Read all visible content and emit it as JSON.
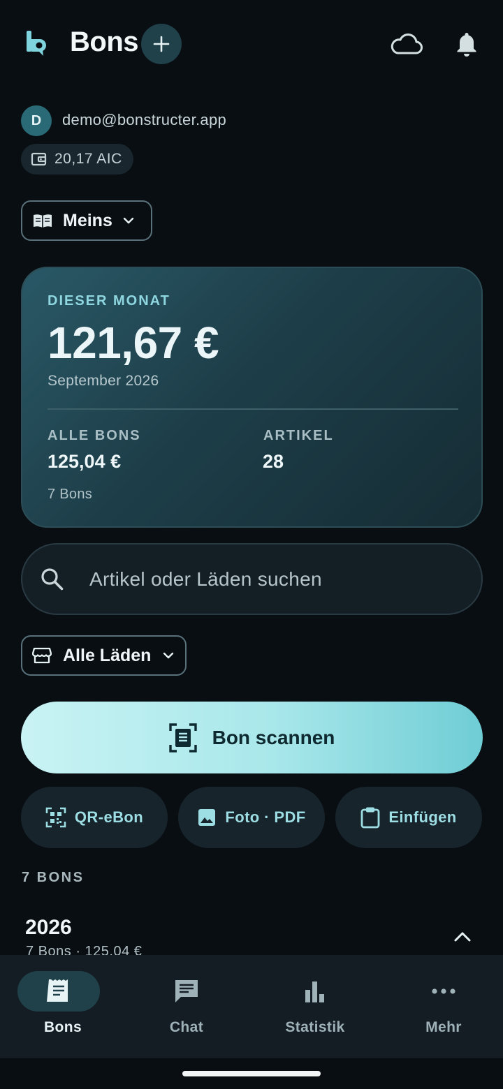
{
  "header": {
    "title": "Bons",
    "add_icon": "plus-icon",
    "cloud_icon": "cloud-icon",
    "bell_icon": "bell-icon"
  },
  "account": {
    "avatar_initial": "D",
    "email": "demo@bonstructer.app",
    "credits": "20,17 AIC"
  },
  "book_selector": {
    "label": "Meins"
  },
  "summary": {
    "kicker": "DIESER MONAT",
    "amount": "121,67 €",
    "month": "September 2026",
    "all_label": "ALLE BONS",
    "all_value": "125,04 €",
    "articles_label": "ARTIKEL",
    "articles_value": "28",
    "count": "7 Bons"
  },
  "search": {
    "placeholder": "Artikel oder Läden suchen"
  },
  "store_filter": {
    "label": "Alle Läden"
  },
  "scan_button": {
    "label": "Bon scannen"
  },
  "secondary_actions": [
    {
      "label": "QR-eBon",
      "icon": "qr-code-icon"
    },
    {
      "label": "Foto · PDF",
      "icon": "image-icon"
    },
    {
      "label": "Einfügen",
      "icon": "clipboard-icon"
    }
  ],
  "list": {
    "kicker": "7 BONS",
    "year": "2026",
    "year_summary": "7 Bons · 125,04 €"
  },
  "bottom_nav": [
    {
      "label": "Bons",
      "icon": "receipt-icon",
      "active": true
    },
    {
      "label": "Chat",
      "icon": "chat-icon",
      "active": false
    },
    {
      "label": "Statistik",
      "icon": "bar-chart-icon",
      "active": false
    },
    {
      "label": "Mehr",
      "icon": "more-icon",
      "active": false
    }
  ],
  "colors": {
    "background": "#090e13",
    "accent": "#9ddde4",
    "card": "#1d3e49",
    "scan_button": "#a8e7ea"
  }
}
